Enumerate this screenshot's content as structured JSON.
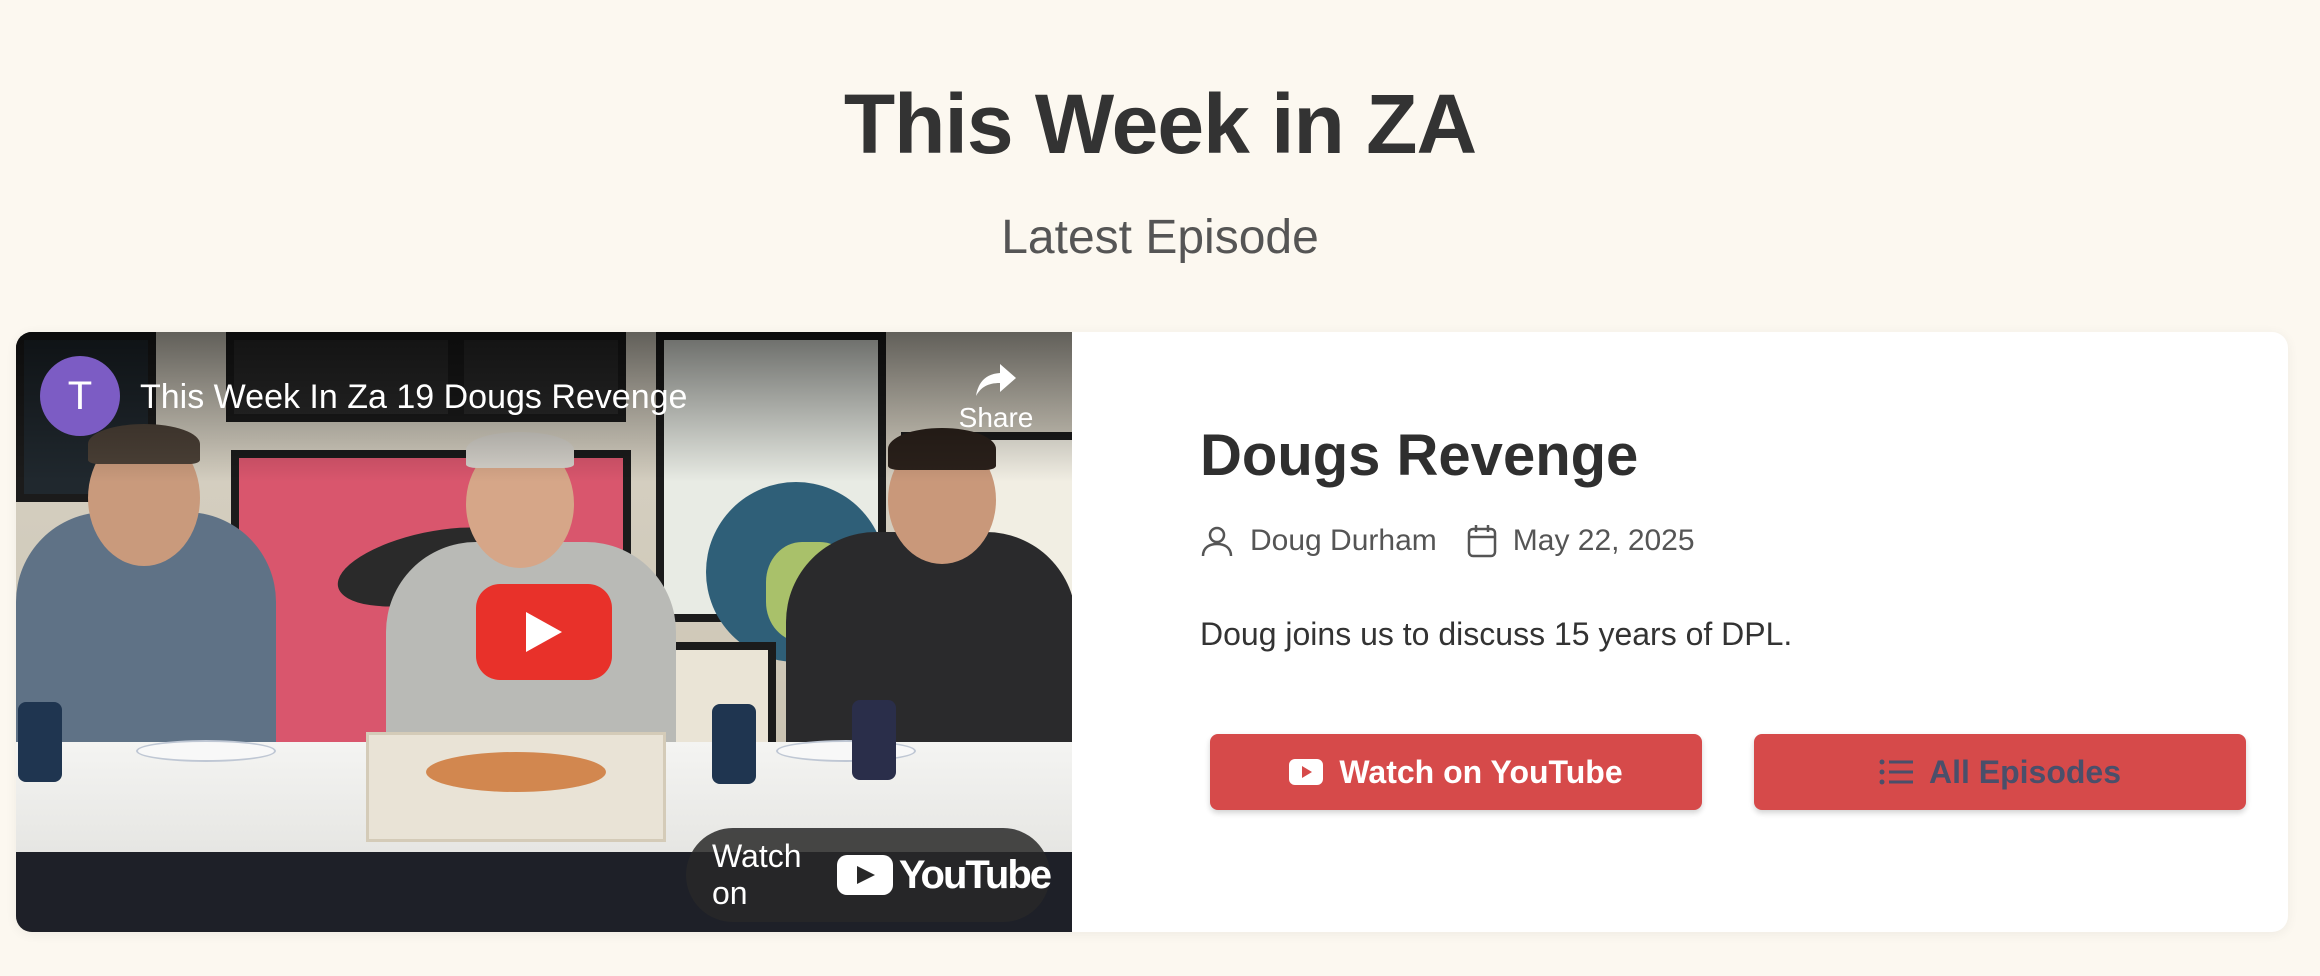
{
  "header": {
    "title": "This Week in ZA",
    "subtitle": "Latest Episode"
  },
  "video": {
    "channel_initial": "T",
    "title": "This Week In Za 19 Dougs Revenge",
    "share_label": "Share",
    "watch_on_label": "Watch on",
    "youtube_word": "YouTube",
    "play_icon": "play-icon"
  },
  "episode": {
    "title": "Dougs Revenge",
    "author": "Doug Durham",
    "date": "May 22, 2025",
    "description": "Doug joins us to discuss 15 years of DPL."
  },
  "buttons": {
    "watch_youtube": "Watch on YouTube",
    "all_episodes": "All Episodes"
  },
  "colors": {
    "background": "#fcf8f0",
    "accent": "#d64a4a",
    "avatar": "#7c5cc4",
    "youtube_red": "#e8312a"
  }
}
